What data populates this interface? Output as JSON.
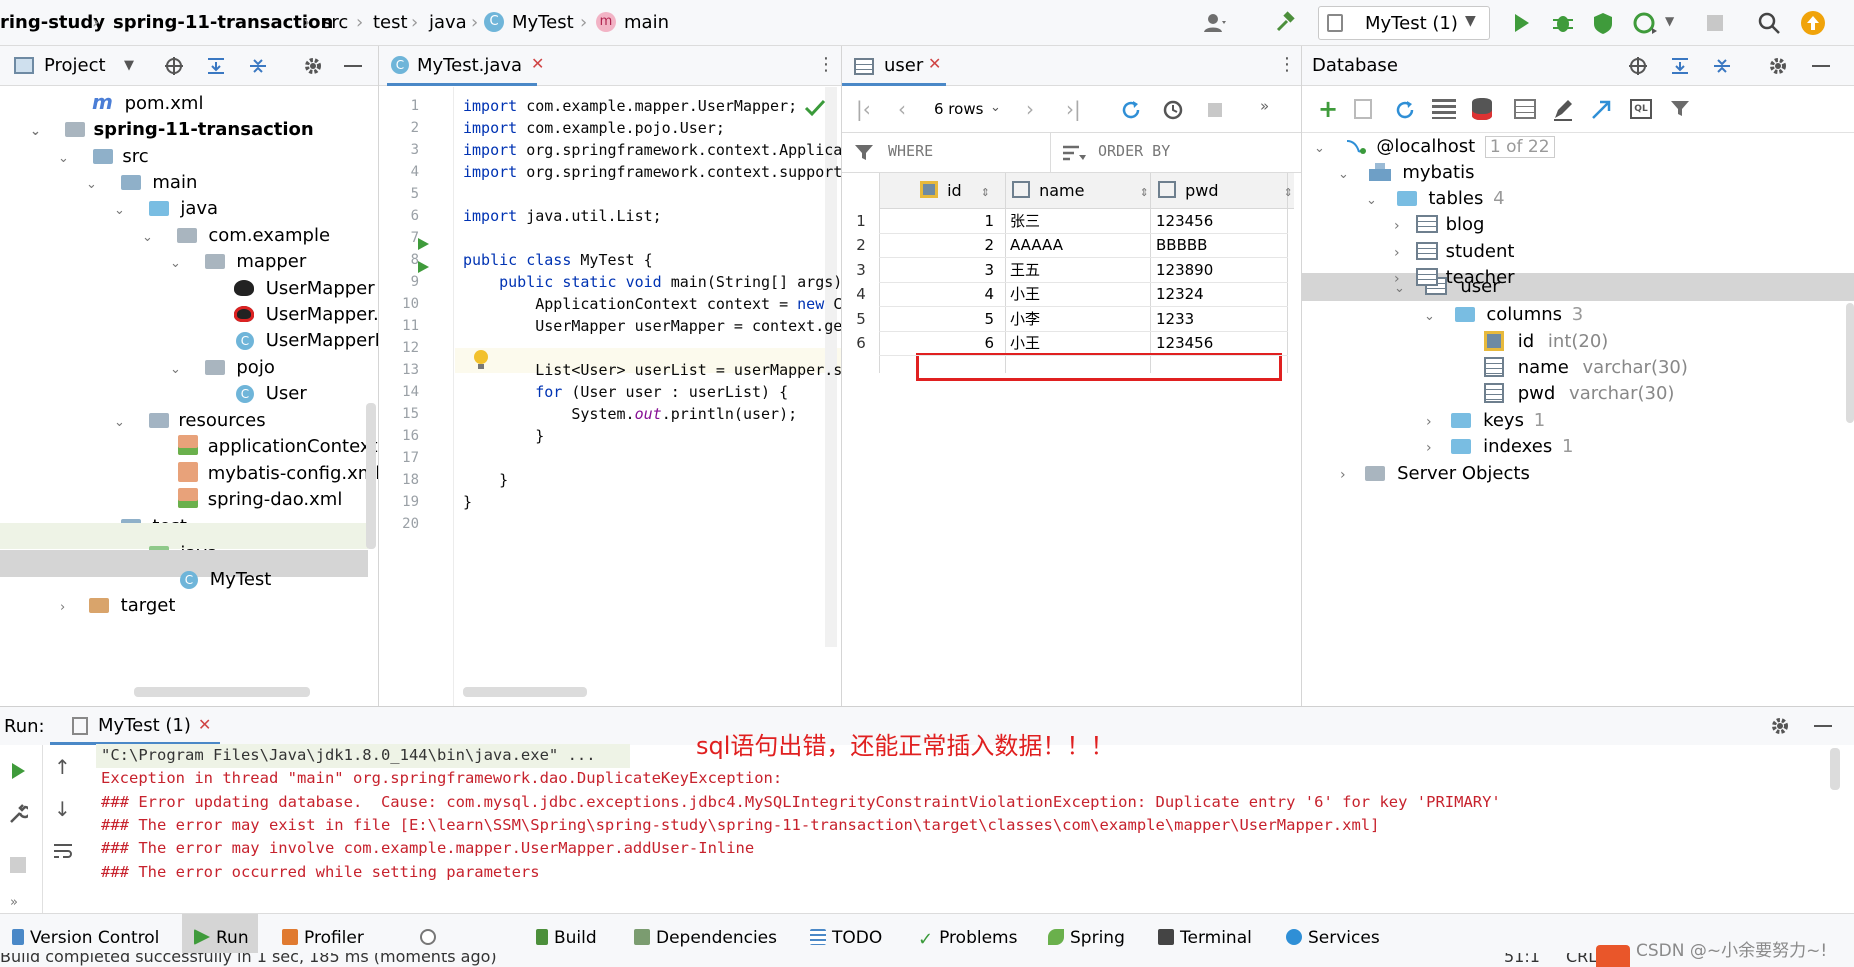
{
  "breadcrumb": [
    "ring-study",
    "spring-11-transaction",
    "src",
    "test",
    "java",
    "MyTest",
    "main"
  ],
  "run_config": "MyTest (1)",
  "project": {
    "title": "Project",
    "items": [
      {
        "label": "pom.xml",
        "icon": "maven-icon"
      },
      {
        "label": "spring-11-transaction",
        "icon": "module-folder-icon"
      },
      {
        "label": "src",
        "icon": "folder-icon"
      },
      {
        "label": "main",
        "icon": "folder-icon"
      },
      {
        "label": "java",
        "icon": "source-folder-icon"
      },
      {
        "label": "com.example",
        "icon": "package-icon"
      },
      {
        "label": "mapper",
        "icon": "package-icon"
      },
      {
        "label": "UserMapper",
        "icon": "mybatis-icon"
      },
      {
        "label": "UserMapper.x",
        "icon": "mybatis-icon"
      },
      {
        "label": "UserMapperIn",
        "icon": "class-icon"
      },
      {
        "label": "pojo",
        "icon": "package-icon"
      },
      {
        "label": "User",
        "icon": "class-icon"
      },
      {
        "label": "resources",
        "icon": "resources-folder-icon"
      },
      {
        "label": "applicationContext.xı",
        "icon": "spring-xml-icon"
      },
      {
        "label": "mybatis-config.xml",
        "icon": "xml-icon"
      },
      {
        "label": "spring-dao.xml",
        "icon": "spring-xml-icon"
      },
      {
        "label": "test",
        "icon": "folder-icon"
      },
      {
        "label": "java",
        "icon": "test-source-folder-icon"
      },
      {
        "label": "MyTest",
        "icon": "class-icon"
      },
      {
        "label": "target",
        "icon": "excluded-folder-icon"
      }
    ]
  },
  "editor": {
    "tab": "MyTest.java",
    "lines": [
      {
        "n": "1",
        "code": "import com.example.mapper.UserMapper;"
      },
      {
        "n": "2",
        "code": "import com.example.pojo.User;"
      },
      {
        "n": "3",
        "code": "import org.springframework.context.Applica"
      },
      {
        "n": "4",
        "code": "import org.springframework.context.support"
      },
      {
        "n": "5",
        "code": ""
      },
      {
        "n": "6",
        "code": "import java.util.List;"
      },
      {
        "n": "7",
        "code": ""
      },
      {
        "n": "8",
        "code": "public class MyTest {"
      },
      {
        "n": "9",
        "code": "    public static void main(String[] args)"
      },
      {
        "n": "10",
        "code": "        ApplicationContext context = new C"
      },
      {
        "n": "11",
        "code": "        UserMapper userMapper = context.ge"
      },
      {
        "n": "12",
        "code": ""
      },
      {
        "n": "13",
        "code": "        List<User> userList = userMapper.s"
      },
      {
        "n": "14",
        "code": "        for (User user : userList) {"
      },
      {
        "n": "15",
        "code": "            System.out.println(user);"
      },
      {
        "n": "16",
        "code": "        }"
      },
      {
        "n": "17",
        "code": ""
      },
      {
        "n": "18",
        "code": "    }"
      },
      {
        "n": "19",
        "code": "}"
      },
      {
        "n": "20",
        "code": ""
      }
    ]
  },
  "table": {
    "tab": "user",
    "rows_label": "6 rows",
    "where_label": "WHERE",
    "order_label": "ORDER BY",
    "columns": [
      "id",
      "name",
      "pwd"
    ],
    "rows": [
      {
        "num": "1",
        "id": "1",
        "name": "张三",
        "pwd": "123456"
      },
      {
        "num": "2",
        "id": "2",
        "name": "AAAAA",
        "pwd": "BBBBB"
      },
      {
        "num": "3",
        "id": "3",
        "name": "王五",
        "pwd": "123890"
      },
      {
        "num": "4",
        "id": "4",
        "name": "小王",
        "pwd": "12324"
      },
      {
        "num": "5",
        "id": "5",
        "name": "小李",
        "pwd": "1233"
      },
      {
        "num": "6",
        "id": "6",
        "name": "小王",
        "pwd": "123456"
      }
    ],
    "highlight_color": "#e02020"
  },
  "database": {
    "title": "Database",
    "host": "@localhost",
    "host_badge": "1 of 22",
    "schema": "mybatis",
    "tables_label": "tables",
    "tables_count": "4",
    "tables": [
      "blog",
      "student",
      "teacher",
      "user"
    ],
    "columns_label": "columns",
    "columns_count": "3",
    "columns": [
      {
        "name": "id",
        "type": "int(20)"
      },
      {
        "name": "name",
        "type": "varchar(30)"
      },
      {
        "name": "pwd",
        "type": "varchar(30)"
      }
    ],
    "keys_label": "keys",
    "keys_count": "1",
    "indexes_label": "indexes",
    "indexes_count": "1",
    "server_objects": "Server Objects"
  },
  "run": {
    "label": "Run:",
    "tab": "MyTest (1)",
    "annotation": "sql语句出错，还能正常插入数据！！！",
    "lines": [
      "\"C:\\Program Files\\Java\\jdk1.8.0_144\\bin\\java.exe\" ...",
      "Exception in thread \"main\" org.springframework.dao.DuplicateKeyException:",
      "### Error updating database.  Cause: com.mysql.jdbc.exceptions.jdbc4.MySQLIntegrityConstraintViolationException: Duplicate entry '6' for key 'PRIMARY'",
      "### The error may exist in file [E:\\learn\\SSM\\Spring\\spring-study\\spring-11-transaction\\target\\classes\\com\\example\\mapper\\UserMapper.xml]",
      "### The error may involve com.example.mapper.UserMapper.addUser-Inline",
      "### The error occurred while setting parameters"
    ]
  },
  "bottom_tabs": [
    "Version Control",
    "Run",
    "Profiler",
    "Build",
    "Dependencies",
    "TODO",
    "Problems",
    "Spring",
    "Terminal",
    "Services"
  ],
  "status": {
    "message": "Build completed successfully in 1 sec, 185 ms (moments ago)",
    "position": "51:1",
    "line_sep": "CRLF"
  },
  "watermark": "CSDN @~小余要努力~!"
}
